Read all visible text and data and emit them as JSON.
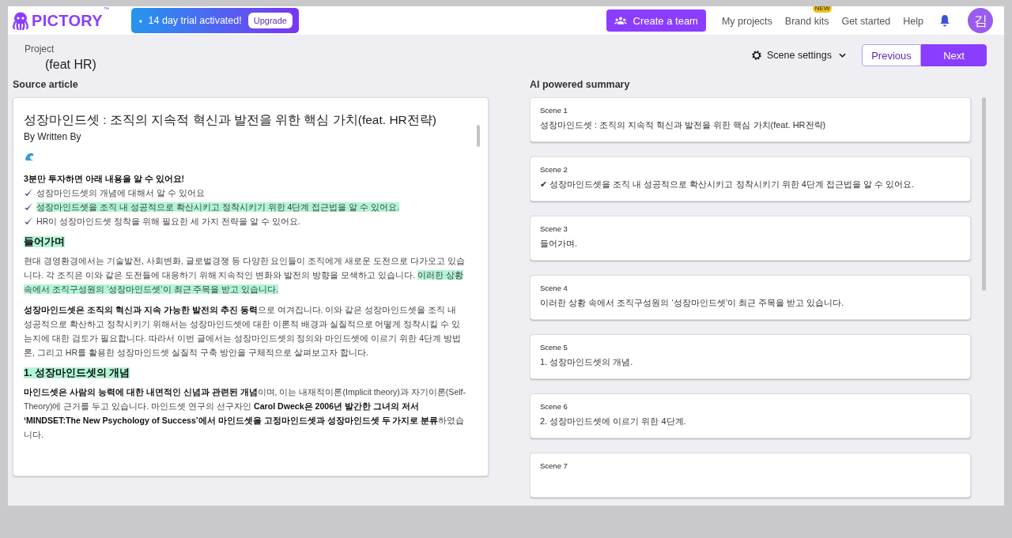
{
  "header": {
    "logo": "PICTORY",
    "logo_mark": "™",
    "trial": {
      "text": "14 day trial activated!",
      "button": "Upgrade"
    },
    "create_team": "Create a team",
    "nav": [
      {
        "label": "My projects"
      },
      {
        "label": "Brand kits",
        "badge": "NEW"
      },
      {
        "label": "Get started"
      },
      {
        "label": "Help"
      }
    ],
    "avatar": "김"
  },
  "project": {
    "label": "Project",
    "name": "(feat HR)"
  },
  "toolbar": {
    "scene_settings": "Scene settings",
    "previous": "Previous",
    "next": "Next"
  },
  "source_article": {
    "heading": "Source article",
    "blocks": [
      {
        "kind": "title",
        "segments": [
          {
            "text": "성장마인드셋 : 조직의 지속적 혁신과 발전을 위한 핵심 가치(feat. HR전략)",
            "bold": false,
            "highlighted": false
          }
        ]
      },
      {
        "kind": "byline",
        "segments": [
          {
            "text": "By Written By",
            "bold": false,
            "highlighted": false
          }
        ]
      },
      {
        "kind": "emoji"
      },
      {
        "kind": "line",
        "segments": [
          {
            "text": "3분만 투자하면 아래 내용을 알 수 있어요!",
            "bold": true,
            "highlighted": false
          }
        ]
      },
      {
        "kind": "check",
        "segments": [
          {
            "text": "성장마인드셋의 개념에 대해서 알 수 있어요",
            "bold": false,
            "highlighted": false
          }
        ]
      },
      {
        "kind": "check",
        "segments": [
          {
            "text": "성장마인드셋을 조직 내 성공적으로 확산시키고 정착시키기 위한 4단계 접근법을 알 수 있어요.",
            "bold": false,
            "highlighted": true
          }
        ]
      },
      {
        "kind": "check",
        "segments": [
          {
            "text": "HR이 성장마인드셋 정착을 위해 필요한 세 가지 전략을 알 수 있어요.",
            "bold": false,
            "highlighted": false
          }
        ]
      },
      {
        "kind": "heading",
        "segments": [
          {
            "text": "들어가며",
            "bold": true,
            "highlighted": true
          }
        ]
      },
      {
        "kind": "paragraph",
        "segments": [
          {
            "text": "현대 경영환경에서는 기술발전, 사회변화, 글로벌경쟁 등 다양한 요인들이 조직에게 새로운 도전으로 다가오고 있습니다. 각 조직은 이와 같은 도전들에 대응하기 위해 지속적인 변화와 발전의 방향을 모색하고 있습니다. ",
            "bold": false,
            "highlighted": false
          },
          {
            "text": "이러한 상황 속에서 조직구성원의 ‘성장마인드셋’이 최근 주목을 받고 있습니다.",
            "bold": false,
            "highlighted": true
          }
        ]
      },
      {
        "kind": "paragraph",
        "segments": [
          {
            "text": "성장마인드셋은 조직의 혁신과 지속 가능한 발전의 추진 동력",
            "bold": true,
            "highlighted": false
          },
          {
            "text": "으로 여겨집니다. 이와 같은 성장마인드셋을 조직 내 성공적으로 확산하고 정착시키기 위해서는 성장마인드셋에 대한 이론적 배경과 실질적으로 어떻게 정착시킬 수 있는지에 대한 검토가 필요합니다. 따라서 이번 글에서는 성장마인드셋의 정의와 마인드셋에 이르기 위한 4단계 방법론, 그리고 HR를 활용한 성장마인드셋 실질적 구축 방안을 구체적으로 살펴보고자 합니다.",
            "bold": false,
            "highlighted": false
          }
        ]
      },
      {
        "kind": "heading",
        "segments": [
          {
            "text": "1. 성장마인드셋의 개념",
            "bold": true,
            "highlighted": true
          }
        ]
      },
      {
        "kind": "paragraph",
        "segments": [
          {
            "text": "마인드셋은 사람의 능력에 대한 내면적인 신념과 관련된 개념",
            "bold": true,
            "highlighted": false
          },
          {
            "text": "이며, 이는 내재적이론(Implicit theory)과 자기이론(Self-Theory)에 근거를 두고 있습니다. 마인드셋 연구의 선구자인 ",
            "bold": false,
            "highlighted": false
          },
          {
            "text": "Carol Dweck은 2006년 발간한 그녀의 저서 ‘MINDSET:The New Psychology of Success’에서 마인드셋을 고정마인드셋과 성장마인드셋 두 가지로 분류",
            "bold": true,
            "highlighted": false
          },
          {
            "text": "하였습니다.",
            "bold": false,
            "highlighted": false
          }
        ]
      }
    ]
  },
  "summary": {
    "heading": "AI powered summary",
    "scenes": [
      {
        "label": "Scene 1",
        "text": "성장마인드셋 : 조직의 지속적 혁신과 발전을 위한 핵심 가치(feat. HR전략)"
      },
      {
        "label": "Scene 2",
        "text": "✔ 성장마인드셋을 조직 내 성공적으로 확산시키고 정착시키기 위한 4단계 접근법을 알 수 있어요."
      },
      {
        "label": "Scene 3",
        "text": "들어가며."
      },
      {
        "label": "Scene 4",
        "text": "이러한 상황 속에서 조직구성원의 ‘성장마인드셋’이 최근 주목을 받고 있습니다."
      },
      {
        "label": "Scene 5",
        "text": "1. 성장마인드셋의 개념."
      },
      {
        "label": "Scene 6",
        "text": "2. 성장마인드셋에 이르기 위한 4단계."
      },
      {
        "label": "Scene 7"
      }
    ]
  }
}
